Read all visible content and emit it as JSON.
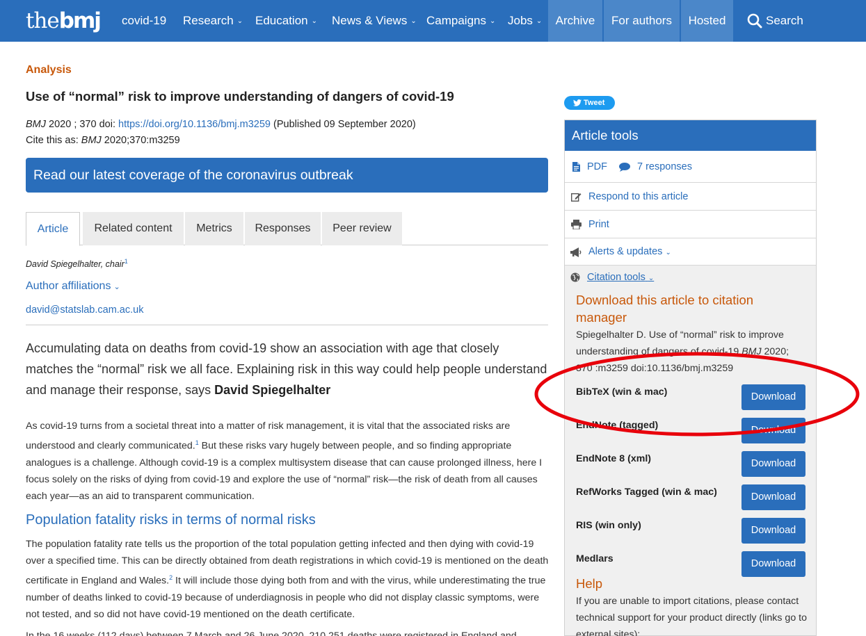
{
  "nav": {
    "logo_light": "the",
    "logo_bold": "bmj",
    "items": [
      {
        "label": "covid-19",
        "dropdown": false
      },
      {
        "label": "Research",
        "dropdown": true
      },
      {
        "label": "Education",
        "dropdown": true
      },
      {
        "label": "News & Views",
        "dropdown": true
      },
      {
        "label": "Campaigns",
        "dropdown": true
      },
      {
        "label": "Jobs",
        "dropdown": true
      }
    ],
    "blocks": [
      "Archive",
      "For authors",
      "Hosted"
    ],
    "search_label": "Search",
    "chevron_glyph": "⌄"
  },
  "article": {
    "kicker": "Analysis",
    "title": "Use of “normal” risk to improve understanding of dangers of covid-19",
    "journal": "BMJ",
    "year_vol": " 2020 ; 370  doi: ",
    "doi_link": "https://doi.org/10.1136/bmj.m3259",
    "published": " (Published 09 September 2020)",
    "cite_prefix": "Cite this as: ",
    "cite_journal": "BMJ",
    "cite_rest": " 2020;370:m3259",
    "covid_banner": "Read our latest coverage of the coronavirus outbreak",
    "tabs": [
      "Article",
      "Related content",
      "Metrics",
      "Responses",
      "Peer review"
    ],
    "author": "David Spiegelhalter, chair",
    "author_sup": "1",
    "affiliations": "Author affiliations",
    "email": "david@statslab.cam.ac.uk",
    "standfirst": "Accumulating data on deaths from covid-19 show an association with age that closely matches the “normal” risk we all face. Explaining risk in this way could help people understand and manage their response, says ",
    "standfirst_bold": "David Spiegelhalter",
    "p1_a": "As covid-19 turns from a societal threat into a matter of risk management, it is vital that the associated risks are understood and clearly communicated.",
    "p1_sup": "1",
    "p1_b": "  But these risks vary hugely between people, and so finding appropriate analogues is a challenge. Although covid-19 is a complex multisystem disease that can cause prolonged illness, here I focus solely on the risks of dying from covid-19 and explore the use of “normal” risk—the risk of death from all causes each year—as an aid to transparent communication.",
    "h2": "Population fatality risks in terms of normal risks",
    "p2_a": "The population fatality rate tells us the proportion of the total population getting infected and then dying with covid-19 over a specified time. This can be directly obtained from death registrations in which covid-19 is mentioned on the death certificate in England and Wales.",
    "p2_sup": "2",
    "p2_b": "  It will include those dying both from and with the virus, while underestimating the true number of deaths linked to covid-19 because of underdiagnosis in people who did not display classic symptoms, were not tested, and so did not have covid-19 mentioned on the death certificate.",
    "p3": "In the 16 weeks (112 days) between 7 March and 26 June 2020, 210 251 deaths were registered in England and"
  },
  "sidebar": {
    "tweet": "Tweet",
    "tools_title": "Article tools",
    "pdf": "PDF",
    "responses": "7 responses",
    "respond": "Respond to this article",
    "print": "Print",
    "alerts": "Alerts & updates",
    "citation_tools": "Citation tools",
    "download_title": "Download this article to citation manager",
    "citation_a": "Spiegelhalter D. Use of “normal” risk to improve understanding of dangers of covid-19 ",
    "citation_journal": "BMJ",
    "citation_b": " 2020; 370 :m3259 doi:10.1136/bmj.m3259",
    "formats": [
      {
        "label": "BibTeX (win & mac)",
        "button": "Download"
      },
      {
        "label": "EndNote (tagged)",
        "button": "Download"
      },
      {
        "label": "EndNote 8 (xml)",
        "button": "Download"
      },
      {
        "label": "RefWorks Tagged (win & mac)",
        "button": "Download"
      },
      {
        "label": "RIS (win only)",
        "button": "Download"
      },
      {
        "label": "Medlars",
        "button": "Download"
      }
    ],
    "help_title": "Help",
    "help_text": "If you are unable to import citations, please contact technical support for your product directly (links go to external sites):"
  },
  "colors": {
    "brand_blue": "#2a6ebb",
    "nav_block": "#4b87c9",
    "accent_orange": "#c8580a",
    "annotation_red": "#e8000b"
  },
  "icons": [
    "search-icon",
    "pdf-icon",
    "comment-icon",
    "edit-icon",
    "print-icon",
    "megaphone-icon",
    "globe-icon",
    "twitter-icon"
  ]
}
